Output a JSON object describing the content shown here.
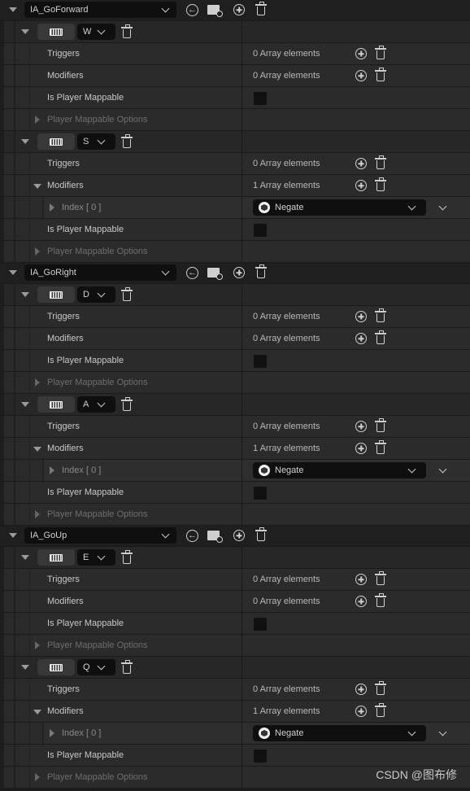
{
  "labels": {
    "triggers": "Triggers",
    "modifiers": "Modifiers",
    "is_player_mappable": "Is Player Mappable",
    "player_mappable_options": "Player Mappable Options",
    "index": "Index [ 0 ]"
  },
  "actions": [
    {
      "name": "IA_GoForward",
      "mappings": [
        {
          "key": "W",
          "triggers": "0 Array elements",
          "modifiers": "0 Array elements",
          "modifier_items": []
        },
        {
          "key": "S",
          "triggers": "0 Array elements",
          "modifiers": "1 Array elements",
          "modifier_items": [
            "Negate"
          ]
        }
      ]
    },
    {
      "name": "IA_GoRight",
      "mappings": [
        {
          "key": "D",
          "triggers": "0 Array elements",
          "modifiers": "0 Array elements",
          "modifier_items": []
        },
        {
          "key": "A",
          "triggers": "0 Array elements",
          "modifiers": "1 Array elements",
          "modifier_items": [
            "Negate"
          ]
        }
      ]
    },
    {
      "name": "IA_GoUp",
      "mappings": [
        {
          "key": "E",
          "triggers": "0 Array elements",
          "modifiers": "0 Array elements",
          "modifier_items": []
        },
        {
          "key": "Q",
          "triggers": "0 Array elements",
          "modifiers": "1 Array elements",
          "modifier_items": [
            "Negate"
          ]
        }
      ]
    }
  ],
  "icons": {
    "expand": "triangle-down-icon",
    "key_selector": "keyboard-icon",
    "use_selected": "arrow-left-circle-icon",
    "browse": "folder-search-icon",
    "add": "plus-circle-icon",
    "remove": "trash-icon",
    "modifier": "negate-icon"
  },
  "watermark": "CSDN @图布修"
}
